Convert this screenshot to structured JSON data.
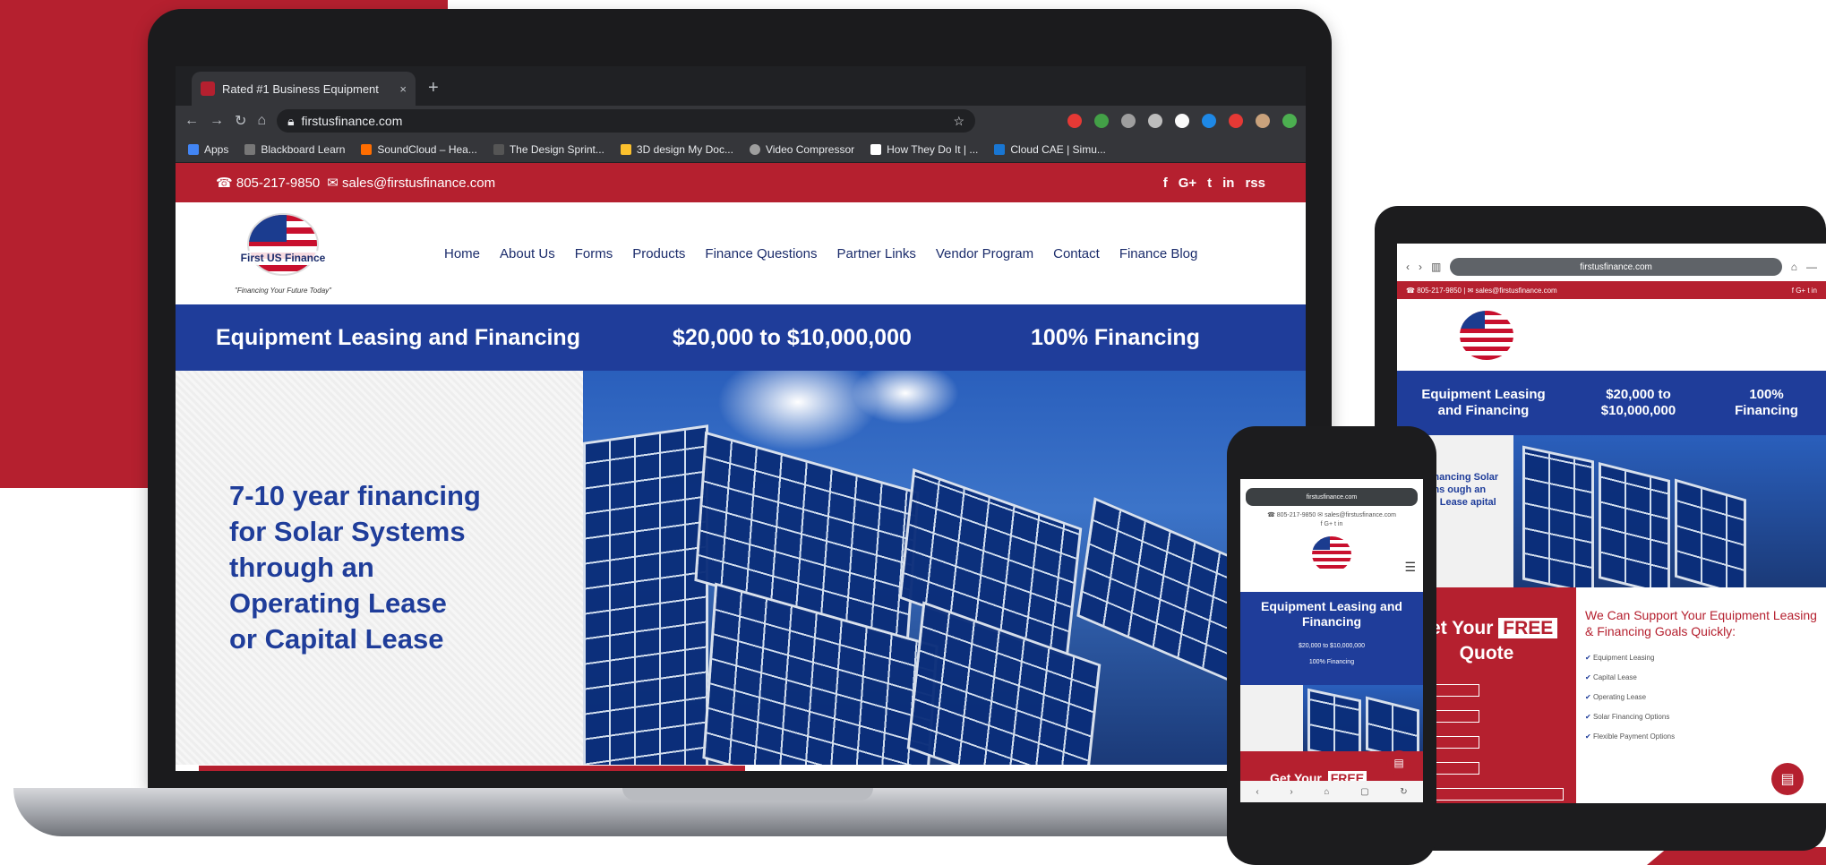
{
  "laptop": {
    "tab_title": "Rated #1 Business Equipment",
    "tab_close": "×",
    "new_tab": "+",
    "url": "firstusfinance.com",
    "bookmarks": [
      "Apps",
      "Blackboard Learn",
      "SoundCloud – Hea...",
      "The Design Sprint...",
      "3D design My Doc...",
      "Video Compressor",
      "How They Do It | ...",
      "Cloud CAE | Simu..."
    ],
    "topbar": {
      "phone": "☎ 805-217-9850",
      "email": "✉ sales@firstusfinance.com",
      "social": [
        "f",
        "G+",
        "t",
        "in",
        "rss"
      ]
    },
    "logo": {
      "name": "First US Finance",
      "tagline": "\"Financing Your Future Today\""
    },
    "nav": [
      "Home",
      "About Us",
      "Forms",
      "Products",
      "Finance Questions",
      "Partner Links",
      "Vendor Program",
      "Contact",
      "Finance Blog"
    ],
    "banner": [
      "Equipment Leasing and Financing",
      "$20,000 to $10,000,000",
      "100% Financing"
    ],
    "hero_lines": [
      "7-10 year financing",
      "for Solar Systems",
      "through an",
      "Operating Lease",
      "or Capital Lease"
    ]
  },
  "tablet": {
    "url": "firstusfinance.com",
    "topbar": "☎ 805-217-9850 | ✉ sales@firstusfinance.com",
    "social": "f G+ t in",
    "banner": [
      "Equipment Leasing and Financing",
      "$20,000 to $10,000,000",
      "100% Financing"
    ],
    "hero_text": "year financing Solar Systems ough an erating Lease apital Lease",
    "quote_title": "Get Your",
    "quote_free": "FREE",
    "quote_word": "Quote",
    "support_text": "We Can Support Your Equipment Leasing & Financing Goals Quickly:",
    "list": [
      "Equipment Leasing",
      "Capital Lease",
      "Operating Lease",
      "Solar Financing Options",
      "Flexible Payment Options"
    ],
    "chat_icon": "chat-bubble"
  },
  "phone": {
    "url": "firstusfinance.com",
    "contact": [
      "☎ 805-217-9850 ✉ sales@firstusfinance.com",
      "f G+ t in"
    ],
    "banner_title": "Equipment Leasing and Financing",
    "banner_sub": [
      "$20,000 to $10,000,000",
      "100% Financing"
    ],
    "quote": "Get Your",
    "quote_free": "FREE",
    "menu_icon": "☰",
    "nav": [
      "‹",
      "›",
      "⌂",
      "▢",
      "↻"
    ]
  },
  "colors": {
    "brand_red": "#b5202f",
    "brand_blue": "#1f3d9a"
  }
}
